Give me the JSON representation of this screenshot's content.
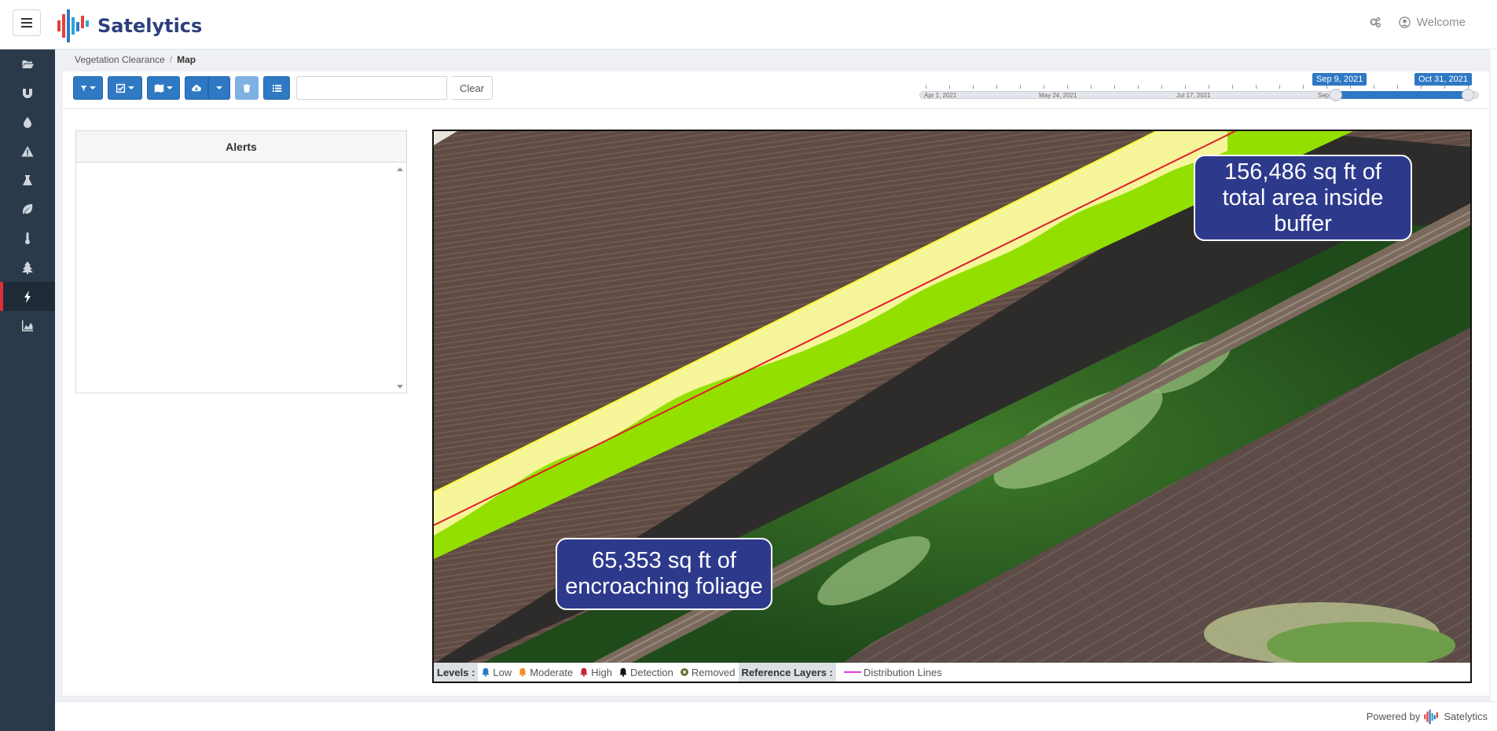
{
  "app": {
    "name": "Satelytics",
    "brand_color": "#2e3f7c",
    "accent_color": "#2f78c4"
  },
  "header": {
    "settings_icon": "cogs-icon",
    "user_icon": "user-circle-icon",
    "welcome_label": "Welcome"
  },
  "sidebar": {
    "items": [
      {
        "icon": "folder-open-icon",
        "active": false
      },
      {
        "icon": "magnet-icon",
        "active": false
      },
      {
        "icon": "droplet-icon",
        "active": false
      },
      {
        "icon": "warning-icon",
        "active": false
      },
      {
        "icon": "flask-icon",
        "active": false
      },
      {
        "icon": "leaf-icon",
        "active": false
      },
      {
        "icon": "thermometer-icon",
        "active": false
      },
      {
        "icon": "tree-icon",
        "active": false
      },
      {
        "icon": "bolt-icon",
        "active": true
      },
      {
        "icon": "area-chart-icon",
        "active": false
      }
    ]
  },
  "breadcrumb": {
    "parent": "Vegetation Clearance",
    "separator": "/",
    "current": "Map"
  },
  "toolbar": {
    "search_value": "",
    "clear_label": "Clear"
  },
  "timeline": {
    "labels": [
      "Apr 1, 2021",
      "May 24, 2021",
      "Jul 17, 2021",
      "Sep"
    ],
    "start_badge": "Sep 9, 2021",
    "end_badge": "Oct 31, 2021"
  },
  "alerts": {
    "title": "Alerts"
  },
  "map": {
    "callout_total": "156,486 sq ft of\ntotal area inside\nbuffer",
    "callout_encroach": "65,353 sq ft of\nencroaching foliage",
    "buffer_color": "#f6f59a",
    "foliage_color": "#93e000",
    "line_color": "#e0202a"
  },
  "legend": {
    "levels_label": "Levels :",
    "low": "Low",
    "moderate": "Moderate",
    "high": "High",
    "detection": "Detection",
    "removed": "Removed",
    "reference_label": "Reference Layers :",
    "distribution": "Distribution Lines",
    "low_color": "#2f78c4",
    "moderate_color": "#f28c1e",
    "high_color": "#c0282d",
    "detection_color": "#111111",
    "removed_color": "#556b2f"
  },
  "footer": {
    "powered_by": "Powered by",
    "brand": "Satelytics"
  }
}
